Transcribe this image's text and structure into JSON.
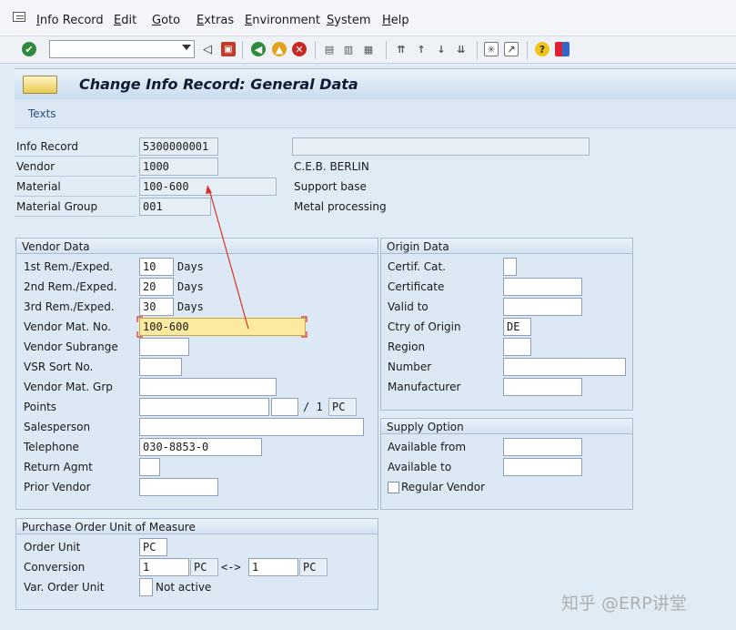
{
  "menu": {
    "items": [
      "Info Record",
      "Edit",
      "Goto",
      "Extras",
      "Environment",
      "System",
      "Help"
    ]
  },
  "toolbar": {
    "command_value": "",
    "icons": [
      "check-icon",
      "back-arrow-icon",
      "save-icon",
      "back-icon",
      "exit-icon",
      "cancel-icon",
      "print-icon",
      "find-icon",
      "find-next-icon",
      "first-page-icon",
      "previous-page-icon",
      "next-page-icon",
      "last-page-icon",
      "create-session-icon",
      "shortcut-icon",
      "help-icon",
      "customize-layout-icon"
    ]
  },
  "title": "Change Info Record: General Data",
  "app_toolbar": {
    "texts_label": "Texts"
  },
  "header": {
    "info_record_label": "Info Record",
    "info_record_value": "5300000001",
    "vendor_label": "Vendor",
    "vendor_value": "1000",
    "vendor_name": "C.E.B. BERLIN",
    "material_label": "Material",
    "material_value": "100-600",
    "material_desc": "Support base",
    "material_group_label": "Material Group",
    "material_group_value": "001",
    "material_group_desc": "Metal processing",
    "long_text_value": ""
  },
  "vendor_data": {
    "title": "Vendor Data",
    "rem1_label": "1st Rem./Exped.",
    "rem1_value": "10",
    "rem1_unit": "Days",
    "rem2_label": "2nd Rem./Exped.",
    "rem2_value": "20",
    "rem2_unit": "Days",
    "rem3_label": "3rd Rem./Exped.",
    "rem3_value": "30",
    "rem3_unit": "Days",
    "vendor_mat_no_label": "Vendor Mat. No.",
    "vendor_mat_no_value": "100-600",
    "vendor_subrange_label": "Vendor Subrange",
    "vendor_subrange_value": "",
    "vsr_sort_label": "VSR Sort No.",
    "vsr_sort_value": "",
    "vendor_mat_grp_label": "Vendor Mat. Grp",
    "vendor_mat_grp_value": "",
    "points_label": "Points",
    "points_value": "",
    "points_per_value": "",
    "points_sep": "/ 1",
    "points_unit": "PC",
    "salesperson_label": "Salesperson",
    "salesperson_value": "",
    "telephone_label": "Telephone",
    "telephone_value": "030-8853-0",
    "return_agmt_label": "Return Agmt",
    "return_agmt_value": "",
    "prior_vendor_label": "Prior Vendor",
    "prior_vendor_value": ""
  },
  "origin_data": {
    "title": "Origin Data",
    "certif_cat_label": "Certif. Cat.",
    "certif_cat_value": "",
    "certificate_label": "Certificate",
    "certificate_value": "",
    "valid_to_label": "Valid to",
    "valid_to_value": "",
    "ctry_origin_label": "Ctry of Origin",
    "ctry_origin_value": "DE",
    "region_label": "Region",
    "region_value": "",
    "number_label": "Number",
    "number_value": "",
    "manufacturer_label": "Manufacturer",
    "manufacturer_value": ""
  },
  "supply_option": {
    "title": "Supply Option",
    "available_from_label": "Available from",
    "available_from_value": "",
    "available_to_label": "Available to",
    "available_to_value": "",
    "regular_vendor_label": "Regular Vendor",
    "regular_vendor_checked": false
  },
  "po_unit": {
    "title": "Purchase Order Unit of Measure",
    "order_unit_label": "Order Unit",
    "order_unit_value": "PC",
    "conversion_label": "Conversion",
    "conv_left_value": "1",
    "conv_left_unit": "PC",
    "conv_arrow": "<->",
    "conv_right_value": "1",
    "conv_right_unit": "PC",
    "var_order_unit_label": "Var. Order Unit",
    "var_order_unit_value": "",
    "var_order_unit_text": "Not active"
  },
  "watermark": "知乎 @ERP讲堂",
  "colors": {
    "highlight_field": "#fbeaa0",
    "annotation_red": "#d9322b",
    "screen_bg": "#dfebf5"
  }
}
